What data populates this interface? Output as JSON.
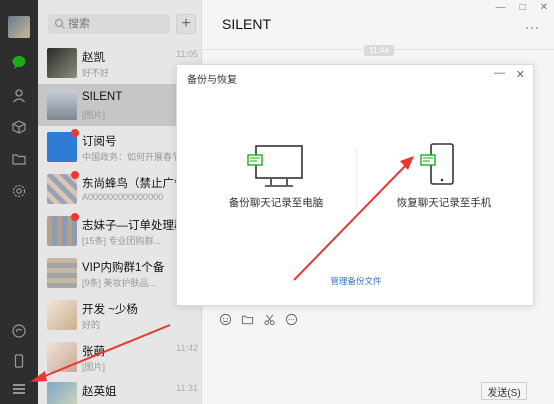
{
  "window": {
    "minimize": "—",
    "maximize": "□",
    "close": "✕"
  },
  "sidebar": {
    "icons": [
      "avatar",
      "chat-bubble-icon",
      "contacts-icon",
      "cube-icon",
      "folder-icon",
      "settings-icon",
      "mini-program-icon",
      "phone-icon",
      "menu-icon"
    ],
    "accent": "#1aad19"
  },
  "search": {
    "placeholder": "搜索"
  },
  "chats": [
    {
      "name": "赵凯",
      "preview": "好不好",
      "time": "11:05",
      "unread": false,
      "active": false
    },
    {
      "name": "SILENT",
      "preview": "[图片]",
      "time": "",
      "unread": false,
      "active": true
    },
    {
      "name": "订阅号",
      "preview": "中国政务：如何开展春节假期...",
      "time": "",
      "unread": true,
      "active": false
    },
    {
      "name": "东尚蜂鸟（禁止广告...",
      "preview": "A000000000000000",
      "time": "",
      "unread": true,
      "active": false
    },
    {
      "name": "志妹子—订单处理群",
      "preview": "[15条] 专业团购群...",
      "time": "",
      "unread": true,
      "active": false
    },
    {
      "name": "VIP内购群1个备",
      "preview": "[9条] 美妆护肤品...",
      "time": "",
      "unread": false,
      "active": false
    },
    {
      "name": "开发 ~少杨",
      "preview": "好的",
      "time": "",
      "unread": false,
      "active": false
    },
    {
      "name": "张萌",
      "preview": "[图片]",
      "time": "11:42",
      "unread": false,
      "active": false
    },
    {
      "name": "赵英姐",
      "preview": "",
      "time": "11:31",
      "unread": false,
      "active": false
    }
  ],
  "chat": {
    "title": "SILENT",
    "more": "···",
    "time_chip": "11:44",
    "send_label": "发送(S)"
  },
  "dialog": {
    "title": "备份与恢复",
    "minimize": "—",
    "close": "✕",
    "backup_label": "备份聊天记录至电脑",
    "restore_label": "恢复聊天记录至手机",
    "manage_link": "管理备份文件"
  },
  "colors": {
    "arrow": "#e8382f",
    "link": "#3c6fc4",
    "green": "#1aad19"
  }
}
